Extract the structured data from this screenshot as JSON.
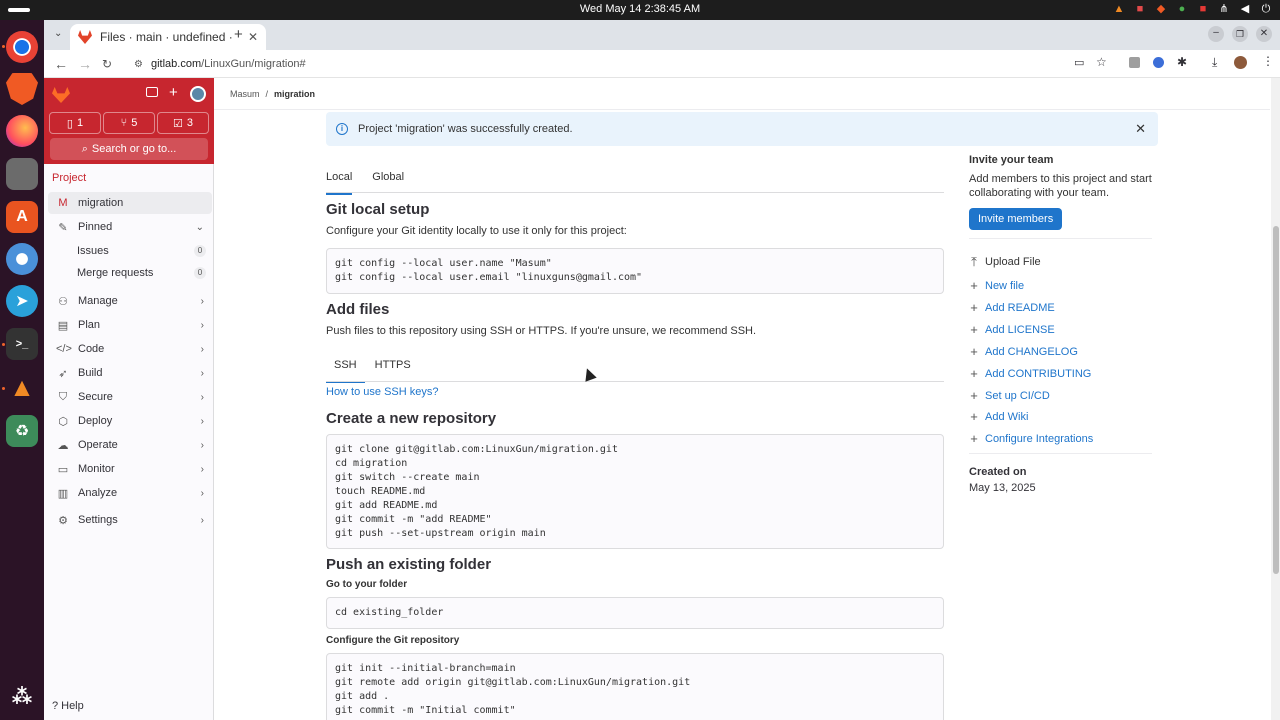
{
  "os": {
    "clock": "Wed May 14  2:38:45 AM"
  },
  "dock": {
    "apps": [
      "chrome-icon",
      "brave-icon",
      "firefox-icon",
      "files-icon",
      "app-center-icon",
      "chromium-icon",
      "telegram-icon",
      "terminal-icon",
      "vlc-icon",
      "trash-icon",
      "show-apps-icon"
    ]
  },
  "browser": {
    "tab_title": "Files · main · undefined ·",
    "new_tab": "+",
    "url_host": "gitlab.com",
    "url_path": "/LinuxGun/migration#"
  },
  "sidebar": {
    "counters": {
      "issues": "1",
      "merge_requests": "5",
      "todos": "3"
    },
    "search_label": "Search or go to...",
    "section_label": "Project",
    "project": {
      "avatar_letter": "M",
      "name": "migration"
    },
    "pinned": {
      "label": "Pinned",
      "items": [
        {
          "label": "Issues",
          "count": "0"
        },
        {
          "label": "Merge requests",
          "count": "0"
        }
      ]
    },
    "items": [
      {
        "label": "Manage",
        "icon": "users-icon"
      },
      {
        "label": "Plan",
        "icon": "plan-icon"
      },
      {
        "label": "Code",
        "icon": "code-icon"
      },
      {
        "label": "Build",
        "icon": "rocket-icon"
      },
      {
        "label": "Secure",
        "icon": "shield-icon"
      },
      {
        "label": "Deploy",
        "icon": "deploy-icon"
      },
      {
        "label": "Operate",
        "icon": "cloud-icon"
      },
      {
        "label": "Monitor",
        "icon": "monitor-icon"
      },
      {
        "label": "Analyze",
        "icon": "chart-icon"
      },
      {
        "label": "Settings",
        "icon": "gear-icon"
      }
    ],
    "help": "Help"
  },
  "breadcrumb": {
    "root": "Masum",
    "sep": "/",
    "current": "migration"
  },
  "alert": {
    "text": "Project 'migration' was successfully created."
  },
  "git_config": {
    "tabs": [
      "Local",
      "Global"
    ],
    "title": "Git local setup",
    "desc": "Configure your Git identity locally to use it only for this project:",
    "code": "git config --local user.name \"Masum\"\ngit config --local user.email \"linuxguns@gmail.com\""
  },
  "add_files": {
    "title": "Add files",
    "desc": "Push files to this repository using SSH or HTTPS. If you're unsure, we recommend SSH.",
    "tabs": [
      "SSH",
      "HTTPS"
    ],
    "help_link": "How to use SSH keys?"
  },
  "new_repo": {
    "title": "Create a new repository",
    "code": "git clone git@gitlab.com:LinuxGun/migration.git\ncd migration\ngit switch --create main\ntouch README.md\ngit add README.md\ngit commit -m \"add README\"\ngit push --set-upstream origin main"
  },
  "push_folder": {
    "title": "Push an existing folder",
    "step1": "Go to your folder",
    "code1": "cd existing_folder",
    "step2": "Configure the Git repository",
    "code2": "git init --initial-branch=main\ngit remote add origin git@gitlab.com:LinuxGun/migration.git\ngit add .\ngit commit -m \"Initial commit\""
  },
  "right_panel": {
    "invite_title": "Invite your team",
    "invite_text": "Add members to this project and start collaborating with your team.",
    "invite_button": "Invite members",
    "actions": [
      "Upload File",
      "New file",
      "Add README",
      "Add LICENSE",
      "Add CHANGELOG",
      "Add CONTRIBUTING",
      "Set up CI/CD",
      "Add Wiki",
      "Configure Integrations"
    ],
    "created_label": "Created on",
    "created_date": "May 13, 2025"
  }
}
